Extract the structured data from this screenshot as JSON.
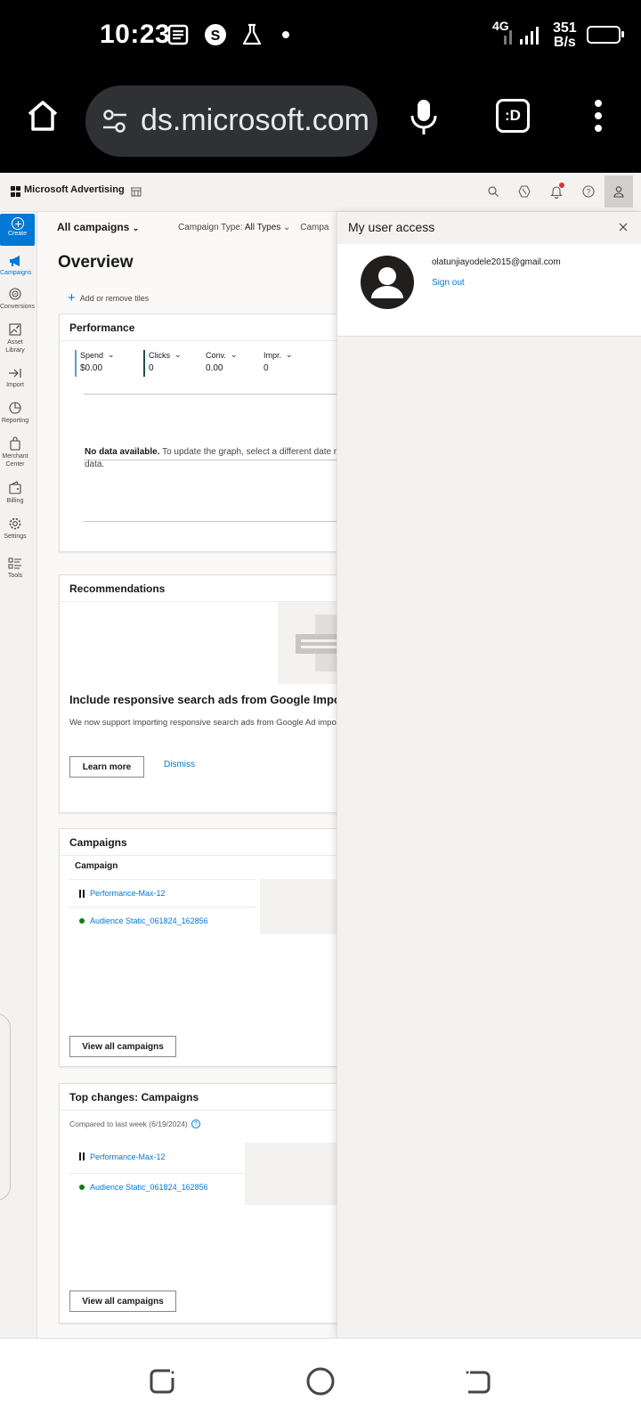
{
  "status_bar": {
    "time": "10:23",
    "network": "4G",
    "speed_value": "351",
    "speed_unit": "B/s"
  },
  "browser": {
    "url": "ds.microsoft.com",
    "tabs_label": ":D"
  },
  "app": {
    "brand": "Microsoft Advertising"
  },
  "rail": {
    "create": "Create",
    "items": [
      {
        "label": "Campaigns"
      },
      {
        "label": "Conversions"
      },
      {
        "label": "Asset Library"
      },
      {
        "label": "Import"
      },
      {
        "label": "Reporting"
      },
      {
        "label": "Merchant Center"
      },
      {
        "label": "Billing"
      },
      {
        "label": "Settings"
      },
      {
        "label": "Tools"
      }
    ]
  },
  "filters": {
    "all_campaigns": "All campaigns",
    "campaign_type_label": "Campaign Type:",
    "campaign_type_value": "All Types",
    "truncated": "Campa"
  },
  "overview": {
    "title": "Overview",
    "add_tiles": "Add or remove tiles"
  },
  "performance": {
    "title": "Performance",
    "metrics": [
      {
        "label": "Spend",
        "value": "$0.00"
      },
      {
        "label": "Clicks",
        "value": "0"
      },
      {
        "label": "Conv.",
        "value": "0.00"
      },
      {
        "label": "Impr.",
        "value": "0"
      }
    ],
    "no_data_bold": "No data available.",
    "no_data_text": " To update the graph, select a different date no data."
  },
  "recommendations": {
    "title": "Recommendations",
    "headline": "Include responsive search ads from Google Impor",
    "body": "We now support importing responsive search ads from Google Ad import!",
    "learn_more": "Learn more",
    "dismiss": "Dismiss"
  },
  "campaigns": {
    "title": "Campaigns",
    "column": "Campaign",
    "rows": [
      {
        "name": "Performance-Max-12",
        "status": "paused"
      },
      {
        "name": "Audience Static_061824_162856",
        "status": "active"
      }
    ],
    "view_all": "View all campaigns"
  },
  "top_changes": {
    "title": "Top changes: Campaigns",
    "compared": "Compared to last week (6/19/2024)",
    "rows": [
      {
        "name": "Performance-Max-12",
        "status": "paused"
      },
      {
        "name": "Audience Static_061824_162856",
        "status": "active"
      }
    ],
    "view_all": "View all campaigns"
  },
  "user_panel": {
    "title": "My user access",
    "email": "olatunjiayodele2015@gmail.com",
    "sign_out": "Sign out"
  },
  "colors": {
    "accent": "#0078d4",
    "active_status": "#107c10",
    "spend_bar": "#5b9bd5",
    "clicks_bar": "#1f4e4a"
  }
}
